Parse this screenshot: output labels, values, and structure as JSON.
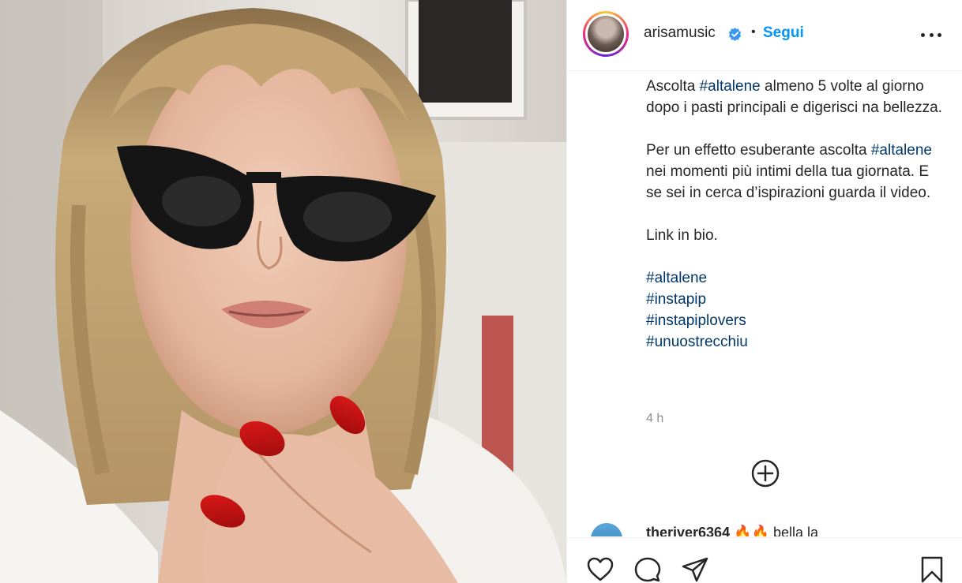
{
  "post": {
    "username": "arisamusic",
    "separator": "•",
    "follow_label": "Segui",
    "caption": {
      "p1_pre": "Ascolta ",
      "p1_tag": "#altalene",
      "p1_post": " almeno 5 volte al giorno dopo i pasti principali e digerisci na bellezza.",
      "p2_tag": "#altalene",
      "p2_pre": "Per un effetto esuberante ascolta ",
      "p2_post": " nei momenti più intimi della tua giornata. E se sei in cerca d’ispirazioni guarda il video.",
      "p3": "Link in bio.",
      "hashtags": [
        "#altalene",
        "#instapip",
        "#instapiplovers",
        "#unuostrecchiu"
      ]
    },
    "timestamp": "4 h",
    "comment_preview": {
      "user": "theriver6364",
      "emoji": "🔥🔥",
      "text": "bella la"
    }
  },
  "icons": {
    "verified": "verified-badge-icon",
    "more": "more-options-icon",
    "load_more": "plus-circle-icon",
    "like": "heart-icon",
    "comment": "comment-icon",
    "share": "paper-plane-icon",
    "save": "bookmark-icon"
  },
  "colors": {
    "accent": "#0095f6",
    "hashtag": "#00376b",
    "text": "#262626",
    "muted": "#8e8e8e"
  }
}
